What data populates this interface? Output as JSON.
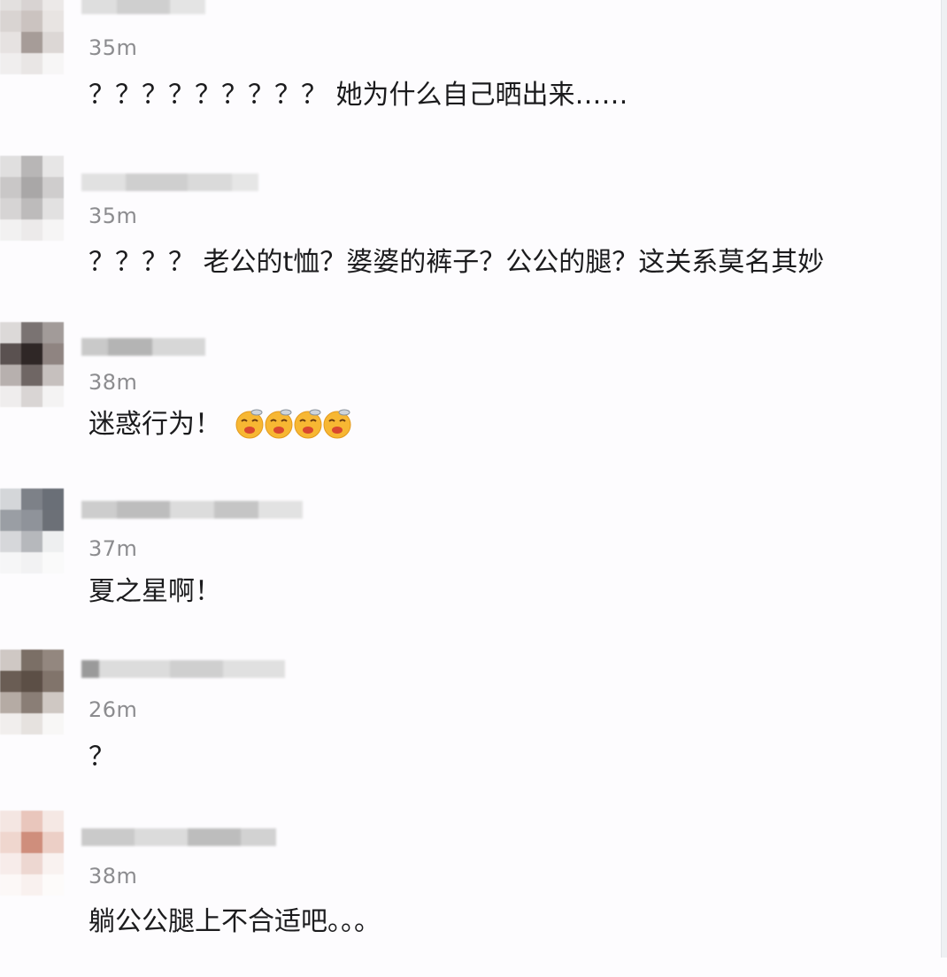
{
  "comments": [
    {
      "time": "35m",
      "text": "？？？？？？？？？ 她为什么自己晒出来……"
    },
    {
      "time": "35m",
      "text": "？？？？ 老公的t恤？婆婆的裤子？公公的腿？这关系莫名其妙"
    },
    {
      "time": "38m",
      "text": "迷惑行为！",
      "emoji": [
        "tired-face-emoji",
        "tired-face-emoji",
        "tired-face-emoji",
        "tired-face-emoji"
      ]
    },
    {
      "time": "37m",
      "text": "夏之星啊！"
    },
    {
      "time": "26m",
      "text": "？"
    },
    {
      "time": "38m",
      "text": "躺公公腿上不合适吧。。。"
    }
  ],
  "colors": {
    "background": "#fdfcfe",
    "timestamp": "#8c8c8f",
    "text": "#1b1b1d",
    "emoji_face": "#f7b733"
  }
}
